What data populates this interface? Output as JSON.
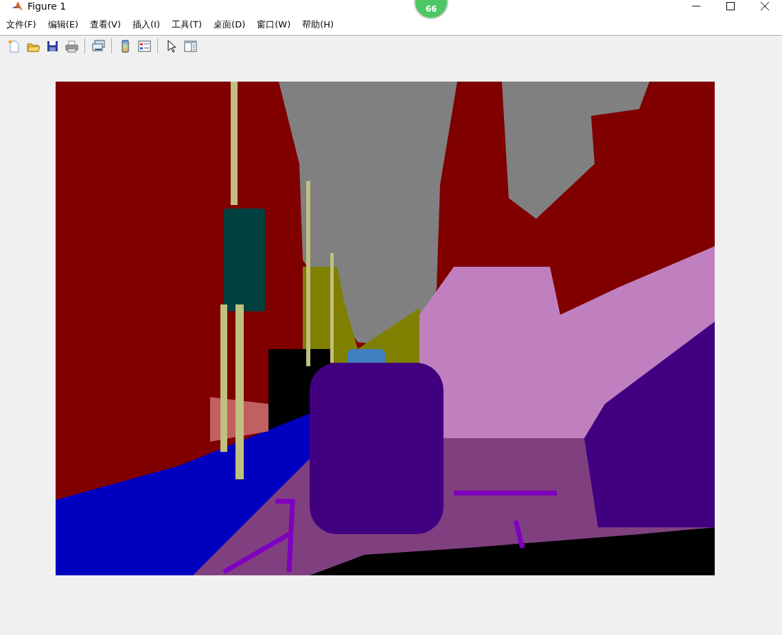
{
  "window": {
    "title": "Figure 1"
  },
  "notification_badge": {
    "count": "66"
  },
  "menu": [
    {
      "label": "文件(F)"
    },
    {
      "label": "编辑(E)"
    },
    {
      "label": "查看(V)"
    },
    {
      "label": "插入(I)"
    },
    {
      "label": "工具(T)"
    },
    {
      "label": "桌面(D)"
    },
    {
      "label": "窗口(W)"
    },
    {
      "label": "帮助(H)"
    }
  ],
  "toolbar": [
    {
      "kind": "new"
    },
    {
      "kind": "open"
    },
    {
      "kind": "save"
    },
    {
      "kind": "print"
    },
    {
      "kind": "separator"
    },
    {
      "kind": "link"
    },
    {
      "kind": "separator"
    },
    {
      "kind": "colorbar"
    },
    {
      "kind": "legend"
    },
    {
      "kind": "separator"
    },
    {
      "kind": "pointer"
    },
    {
      "kind": "panel"
    }
  ]
}
